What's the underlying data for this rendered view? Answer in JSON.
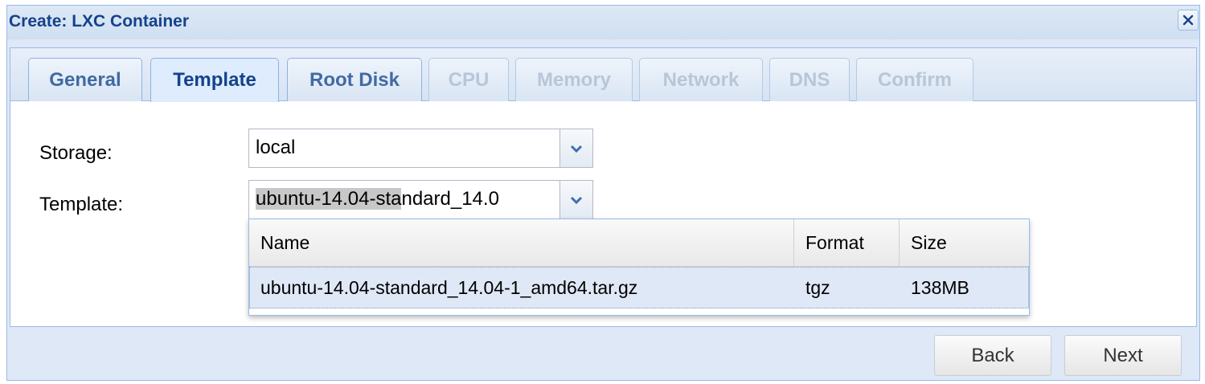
{
  "window": {
    "title": "Create: LXC Container"
  },
  "tabs": [
    {
      "label": "General",
      "state": "enabled"
    },
    {
      "label": "Template",
      "state": "active"
    },
    {
      "label": "Root Disk",
      "state": "enabled"
    },
    {
      "label": "CPU",
      "state": "disabled"
    },
    {
      "label": "Memory",
      "state": "disabled"
    },
    {
      "label": "Network",
      "state": "disabled"
    },
    {
      "label": "DNS",
      "state": "disabled"
    },
    {
      "label": "Confirm",
      "state": "disabled"
    }
  ],
  "form": {
    "storage": {
      "label": "Storage:",
      "value": "local"
    },
    "template": {
      "label": "Template:",
      "value_selected_part": "ubuntu-14.04-sta",
      "value_rest": "ndard_14.0"
    }
  },
  "template_picker": {
    "columns": [
      "Name",
      "Format",
      "Size"
    ],
    "rows": [
      {
        "name": "ubuntu-14.04-standard_14.04-1_amd64.tar.gz",
        "format": "tgz",
        "size": "138MB"
      }
    ]
  },
  "buttons": {
    "back": "Back",
    "next": "Next"
  },
  "icons": {
    "close": "close-icon",
    "dropdown": "chevron-down-icon"
  },
  "colors": {
    "title": "#15428b",
    "window_bg": "#dfe8f6",
    "border": "#99bbe8",
    "selected_row": "#dfe8f6"
  }
}
